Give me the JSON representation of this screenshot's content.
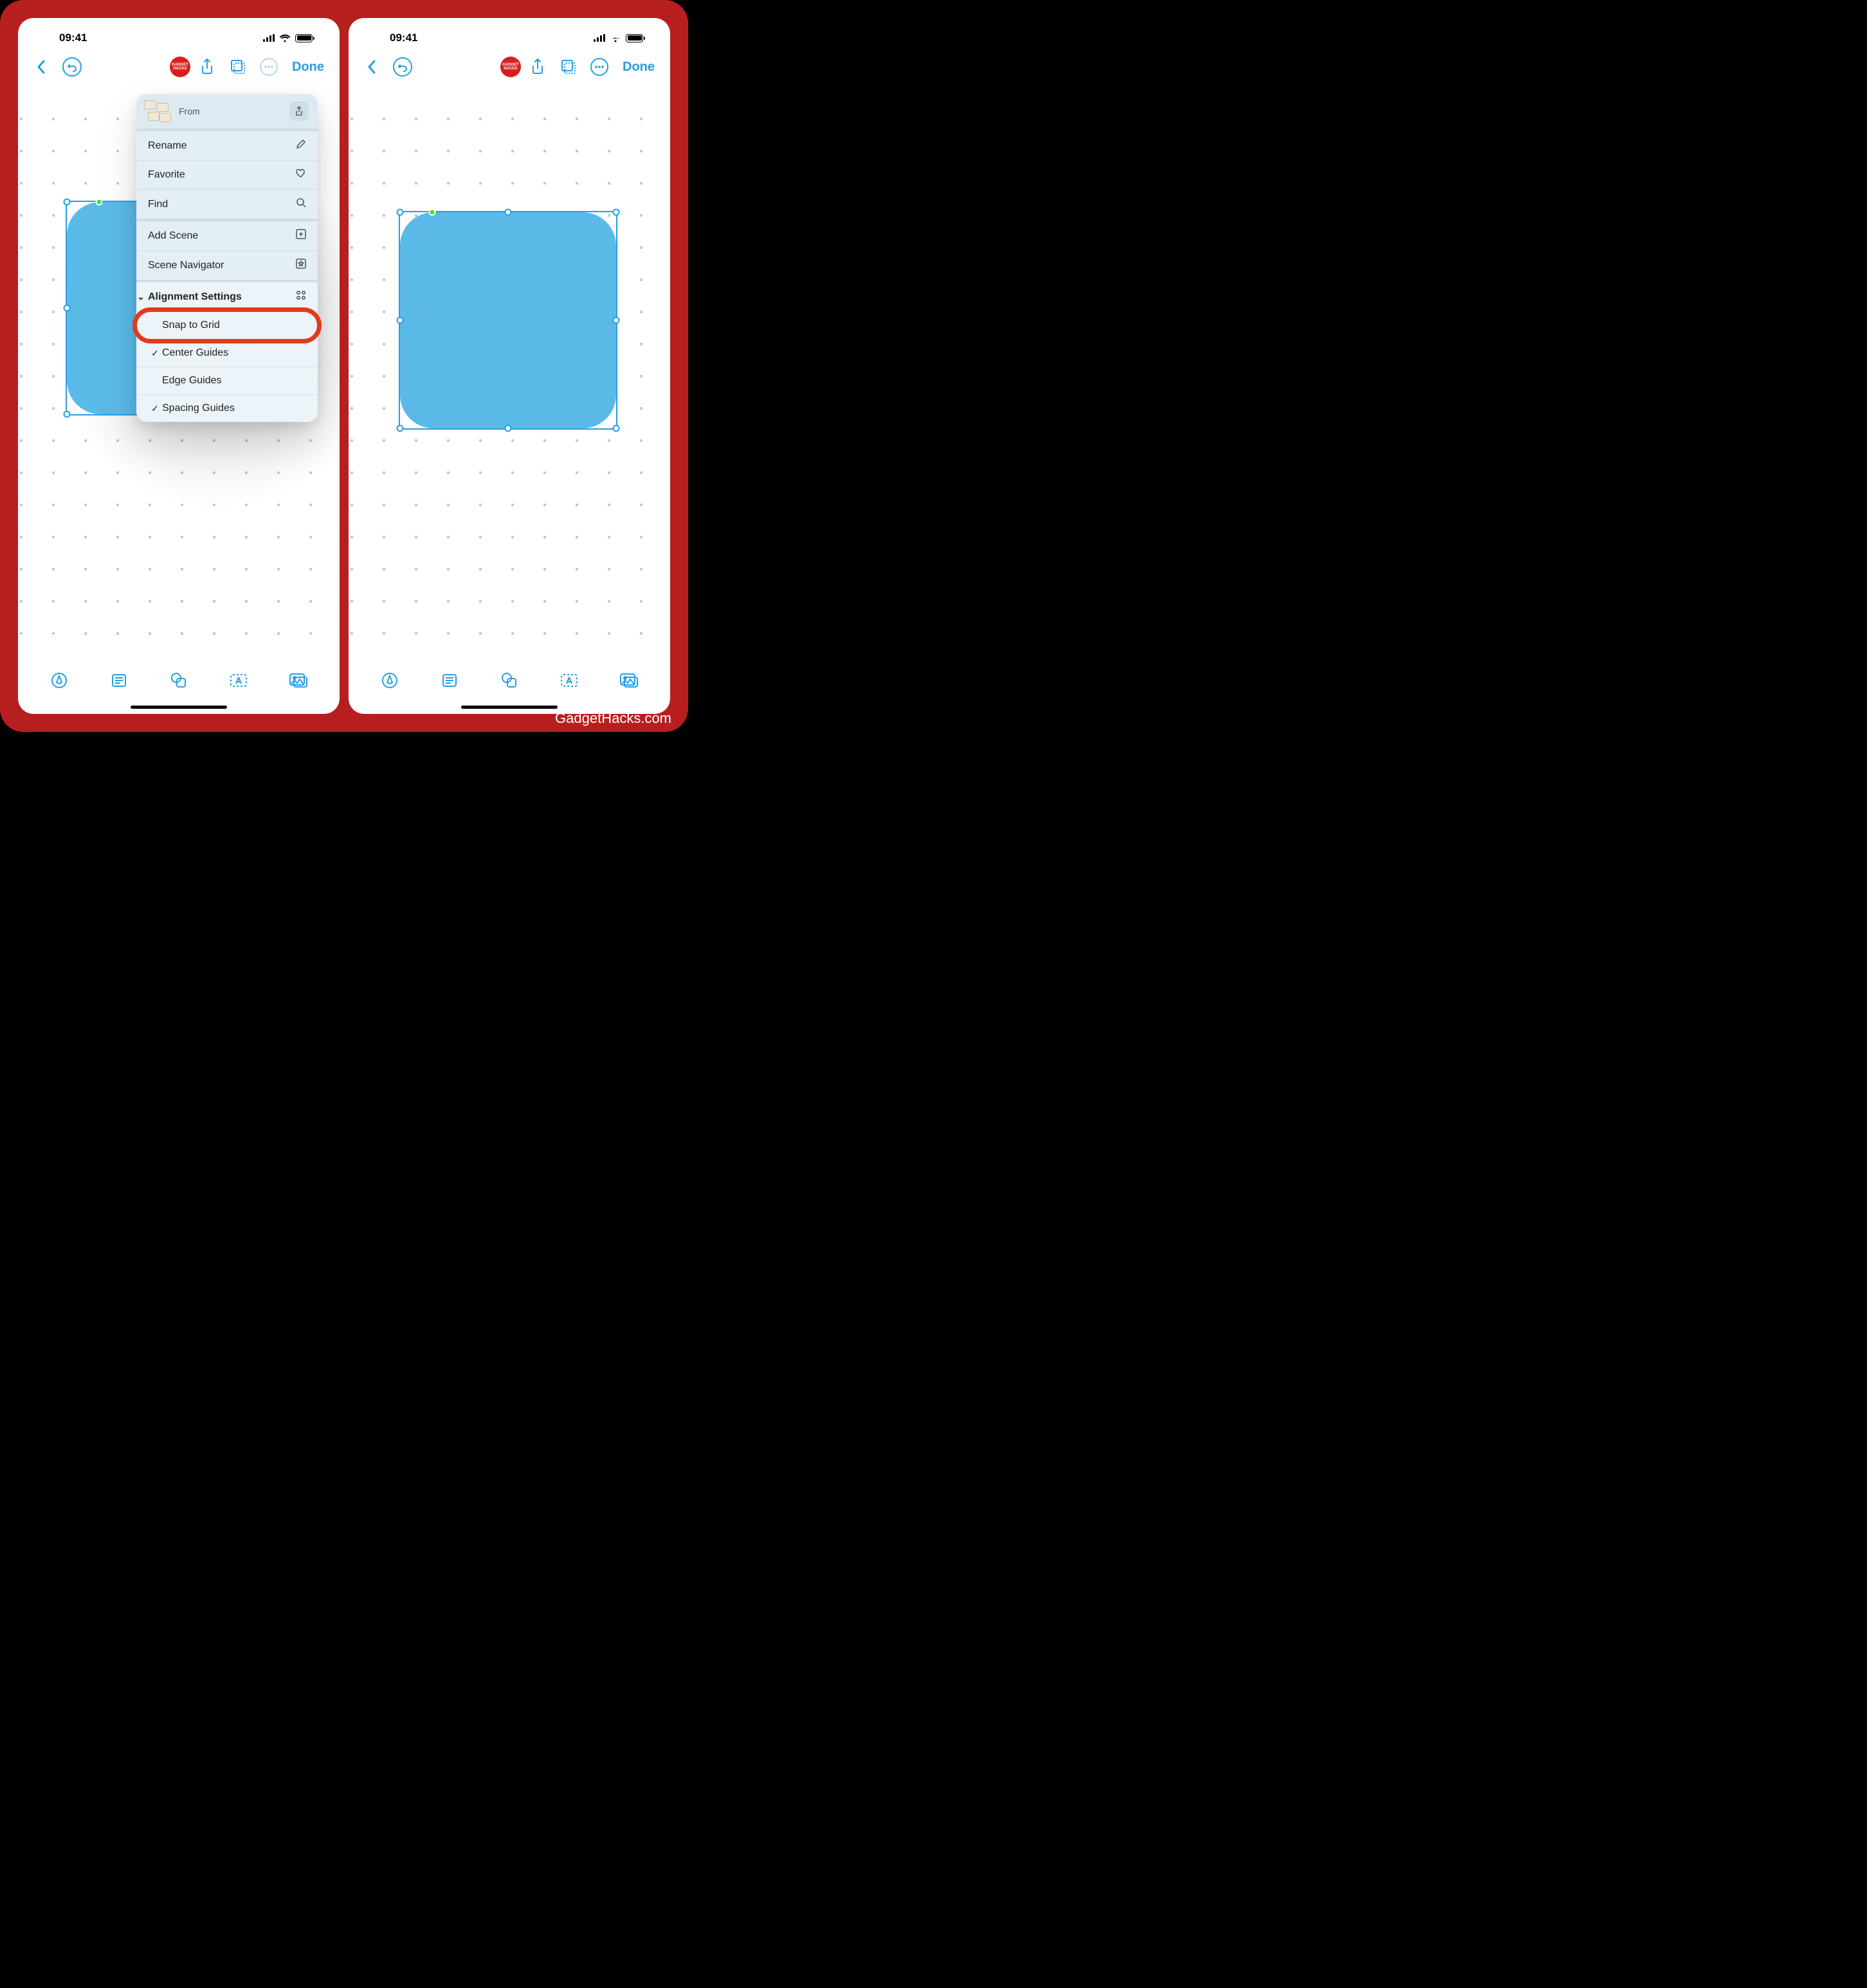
{
  "status": {
    "time": "09:41"
  },
  "toolbar": {
    "done_label": "Done",
    "brand": "GADGET HACKS"
  },
  "popover": {
    "from_label": "From",
    "rows": {
      "rename": "Rename",
      "favorite": "Favorite",
      "find": "Find",
      "add_scene": "Add Scene",
      "scene_navigator": "Scene Navigator"
    },
    "alignment": {
      "header": "Alignment Settings",
      "snap_to_grid": "Snap to Grid",
      "center_guides": "Center Guides",
      "edge_guides": "Edge Guides",
      "spacing_guides": "Spacing Guides"
    }
  },
  "footer": {
    "credit": "GadgetHacks.com"
  }
}
